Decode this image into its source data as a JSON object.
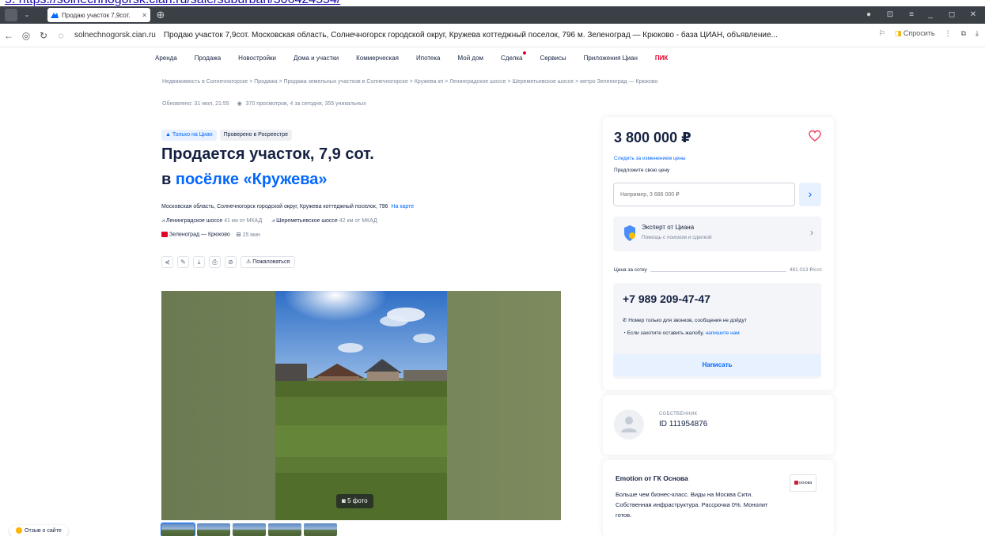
{
  "browser": {
    "url_strip": "5. https://solnechnogorsk.cian.ru/sale/suburban/306424554/",
    "tab_title": "Продаю участок 7,9сот.",
    "domain": "solnechnogorsk.cian.ru",
    "page_title": "Продаю участок 7,9сот. Московская область, Солнечногорск городской округ, Кружева коттеджный поселок, 796 м. Зеленоград — Крюково - база ЦИАН, объявление...",
    "ask_label": "Спросить"
  },
  "nav": {
    "items": [
      "Аренда",
      "Продажа",
      "Новостройки",
      "Дома и участки",
      "Коммерческая",
      "Ипотека",
      "Мой дом",
      "Сделка",
      "Сервисы",
      "Приложения Циан"
    ],
    "pik": "ПИК"
  },
  "listing": {
    "breadcrumbs": "Недвижимость в Солнечногорске  >  Продажа  >  Продажа земельных участков в Солнечногорске  >  Кружева кп  >  Ленинградское шоссе  >  Шереметьевское шоссе  >  метро Зеленоград — Крюково",
    "meta_updated": "Обновлено: 31 июл, 21:55",
    "meta_views": "370 просмотров, 4 за сегодня, 355 уникальных",
    "badge_cian": "Только на Циан",
    "badge_rosreestr": "Проверено в Росреестре",
    "title_line1": "Продается участок, 7,9 сот.",
    "title_prefix": "в ",
    "title_link": "посёлке «Кружева»",
    "address": "Московская область, Солнечногорск городской округ, Кружева коттеджный поселок, 796",
    "map_link": "На карте",
    "hw1_name": "Ленинградское шоссе",
    "hw1_dist": "41 км от МКАД",
    "hw2_name": "Шереметьевское шоссе",
    "hw2_dist": "42 км от МКАД",
    "metro_name": "Зеленоград — Крюково",
    "metro_time": "25 мин",
    "report_label": "Пожаловаться",
    "photo_count": "5 фото",
    "review_label": "Отзыв о сайте"
  },
  "price_card": {
    "price": "3 800 000 ₽",
    "follow_link": "Следить за изменением цены",
    "offer_label": "Предложите свою цену",
    "offer_placeholder": "Например, 3 686 000 ₽",
    "expert_title": "Эксперт от Циана",
    "expert_sub": "Помощь с поиском и сделкой",
    "price_per_sotka_label": "Цена за сотку",
    "price_per_sotka_value": "481 013 ₽/сот.",
    "phone": "+7 989 209-47-47",
    "note_calls": "Номер только для звонков, сообщения не дойдут",
    "note_complaint": "Если захотите оставить жалобу,",
    "note_complaint_link": "напишите нам",
    "write_label": "Написать"
  },
  "owner": {
    "role": "СОБСТВЕННИК",
    "id": "ID 111954876"
  },
  "ad": {
    "title": "Emotion от ГК Основа",
    "text": "Больше чем бизнес-класс. Виды на Москва Сити. Собственная инфраструктура. Рассрочка 0%. Монолит готов.",
    "logo_text": "основа"
  },
  "colors": {
    "accent": "#0468ff",
    "text": "#152242",
    "muted": "#7a8599",
    "pik_red": "#e5002b",
    "heart": "#e84260"
  }
}
